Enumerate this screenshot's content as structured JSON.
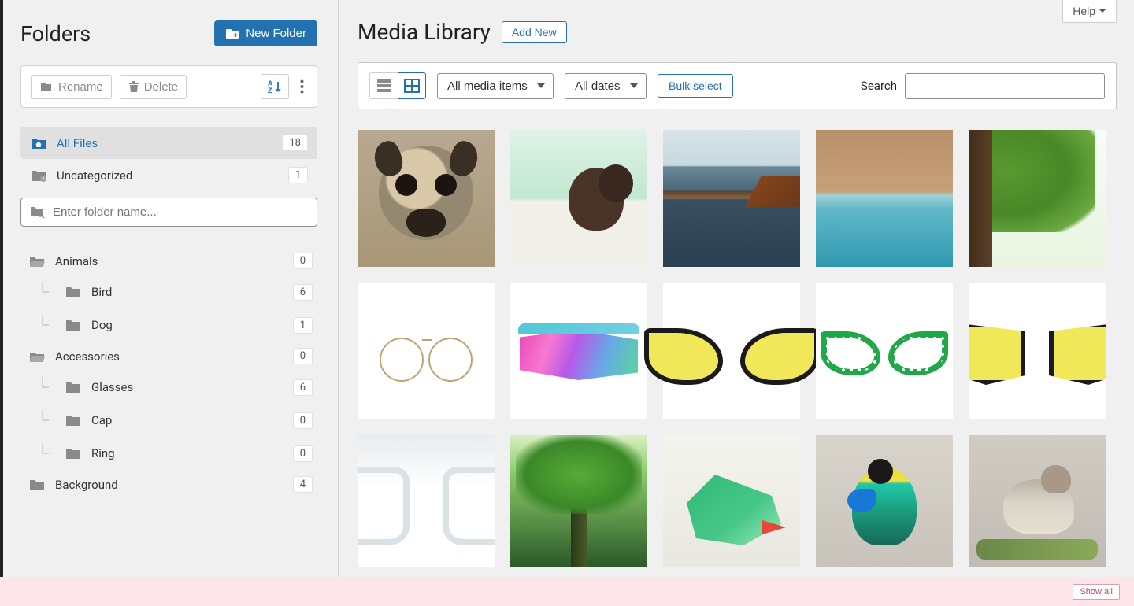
{
  "sidebar": {
    "title": "Folders",
    "new_folder_label": "New Folder",
    "rename_label": "Rename",
    "delete_label": "Delete",
    "all_files": {
      "label": "All Files",
      "count": "18"
    },
    "uncategorized": {
      "label": "Uncategorized",
      "count": "1"
    },
    "search_placeholder": "Enter folder name...",
    "tree": [
      {
        "label": "Animals",
        "count": "0",
        "children": [
          {
            "label": "Bird",
            "count": "6"
          },
          {
            "label": "Dog",
            "count": "1"
          }
        ]
      },
      {
        "label": "Accessories",
        "count": "0",
        "children": [
          {
            "label": "Glasses",
            "count": "6"
          },
          {
            "label": "Cap",
            "count": "0"
          },
          {
            "label": "Ring",
            "count": "0"
          }
        ]
      },
      {
        "label": "Background",
        "count": "4",
        "children": []
      }
    ]
  },
  "main": {
    "help_label": "Help",
    "page_title": "Media Library",
    "add_new_label": "Add New",
    "filter_media": "All media items",
    "filter_date": "All dates",
    "bulk_label": "Bulk select",
    "search_label": "Search",
    "thumbnails": [
      "pug-dog",
      "brown-puppy",
      "mountain-lake",
      "beach-aerial",
      "green-tree",
      "round-glasses",
      "sport-sunglasses",
      "cat-eye-yellow",
      "green-cat-eye",
      "yellow-square-sunglasses",
      "clear-glasses",
      "forest-tree",
      "green-parrot",
      "colorful-tanager",
      "small-bird"
    ]
  },
  "footer": {
    "show_all": "Show all"
  }
}
